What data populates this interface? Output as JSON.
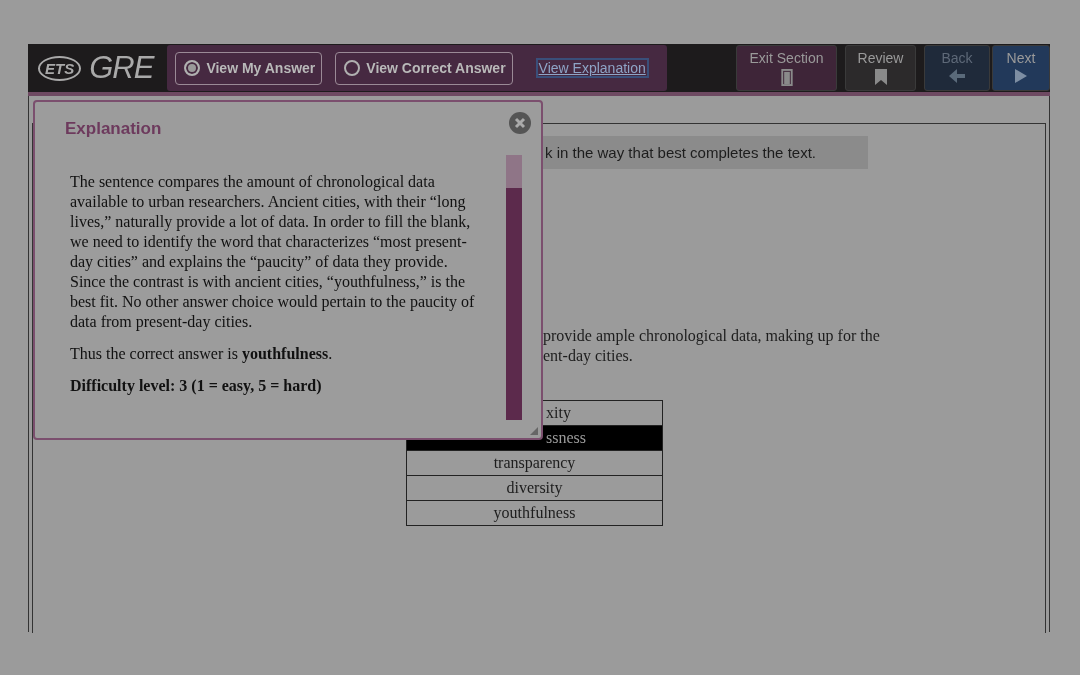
{
  "header": {
    "logo_small": "ETS",
    "logo_large": "GRE",
    "answer_toggles": [
      {
        "label": "View My Answer",
        "selected": true
      },
      {
        "label": "View Correct Answer",
        "selected": false
      }
    ],
    "explanation_link": "View Explanation",
    "nav_buttons": [
      {
        "label": "Exit Section",
        "kind": "exit",
        "disabled": false
      },
      {
        "label": "Review",
        "kind": "review",
        "disabled": false
      },
      {
        "label": "Back",
        "kind": "back",
        "disabled": true
      },
      {
        "label": "Next",
        "kind": "next",
        "disabled": false
      }
    ]
  },
  "question": {
    "instruction": "k in the way that best completes the text.",
    "sentence_lines": [
      "provide ample chronological data, making up for the",
      "ent-day cities."
    ],
    "choices": [
      {
        "text": "xity",
        "covered": true,
        "selected": false
      },
      {
        "text": "ssness",
        "covered": true,
        "selected": true
      },
      {
        "text": "transparency",
        "covered": false,
        "selected": false
      },
      {
        "text": "diversity",
        "covered": false,
        "selected": false
      },
      {
        "text": "youthfulness",
        "covered": false,
        "selected": false
      }
    ]
  },
  "explanation": {
    "title": "Explanation",
    "paragraphs": [
      "The sentence compares the amount of chronological data available to urban researchers. Ancient cities, with their “long lives,” naturally provide a lot of data. In order to fill the blank, we need to identify the word that characterizes “most present-day cities” and explains the “paucity” of data they provide. Since the contrast is with ancient cities, “youthfulness,” is the best fit. No other answer choice would pertain to the paucity of data from present-day cities.",
      "Thus the correct answer is **youthfulness**.",
      "**Difficulty level: 3 (1 = easy, 5 = hard)**"
    ]
  }
}
